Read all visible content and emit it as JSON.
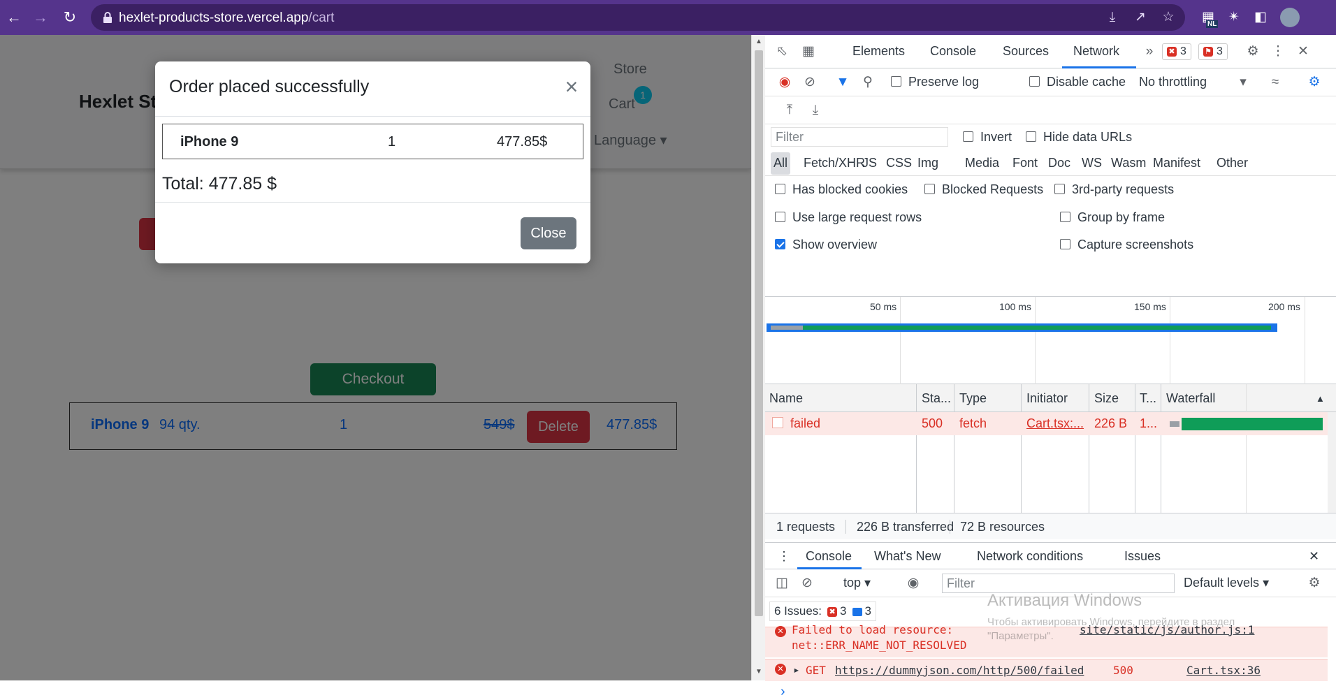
{
  "browser": {
    "url_host": "hexlet-products-store.vercel.app",
    "url_path": "/cart",
    "profile_badge": "NL"
  },
  "page": {
    "brand": "Hexlet Sto",
    "nav": {
      "store": "Store",
      "cart": "Cart",
      "cart_count": "1",
      "language": "Language ▾"
    },
    "total_partial": "$",
    "checkout_label": "Checkout",
    "cart_row": {
      "name": "iPhone 9",
      "stock": "94 qty.",
      "quantity": "1",
      "old_price": "549$",
      "delete_label": "Delete",
      "price": "477.85$"
    }
  },
  "modal": {
    "title": "Order placed successfully",
    "item": {
      "name": "iPhone 9",
      "quantity": "1",
      "price": "477.85$"
    },
    "total": "Total: 477.85 $",
    "close_label": "Close"
  },
  "devtools": {
    "tabs": [
      "Elements",
      "Console",
      "Sources",
      "Network"
    ],
    "active_tab": "Network",
    "errors_count": "3",
    "warnings_count": "3",
    "options": {
      "preserve_log": "Preserve log",
      "disable_cache": "Disable cache",
      "throttling": "No throttling",
      "filter_placeholder": "Filter",
      "invert": "Invert",
      "hide_data_urls": "Hide data URLs",
      "has_blocked_cookies": "Has blocked cookies",
      "blocked_requests": "Blocked Requests",
      "third_party": "3rd-party requests",
      "large_rows": "Use large request rows",
      "group_by_frame": "Group by frame",
      "show_overview": "Show overview",
      "capture_screenshots": "Capture screenshots"
    },
    "type_filters": [
      "All",
      "Fetch/XHR",
      "JS",
      "CSS",
      "Img",
      "Media",
      "Font",
      "Doc",
      "WS",
      "Wasm",
      "Manifest",
      "Other"
    ],
    "timeline_ticks": [
      "50 ms",
      "100 ms",
      "150 ms",
      "200 ms"
    ],
    "columns": [
      "Name",
      "Sta...",
      "Type",
      "Initiator",
      "Size",
      "T...",
      "Waterfall"
    ],
    "request": {
      "name": "failed",
      "status": "500",
      "type": "fetch",
      "initiator": "Cart.tsx:...",
      "size": "226 B",
      "time": "1..."
    },
    "summary": {
      "requests": "1 requests",
      "transferred": "226 B transferred",
      "resources": "72 B resources"
    },
    "drawer": {
      "tabs": [
        "Console",
        "What's New",
        "Network conditions",
        "Issues"
      ],
      "context": "top",
      "filter_placeholder": "Filter",
      "levels": "Default levels",
      "issues_label": "6 Issues:",
      "issues_errors": "3",
      "issues_info": "3",
      "messages": [
        {
          "text_1": "Failed to load resource:",
          "text_2": "net::ERR_NAME_NOT_RESOLVED",
          "source": "site/static/js/author.js:1"
        },
        {
          "method": "GET",
          "url": "https://dummyjson.com/http/500/failed",
          "status": "500",
          "source": "Cart.tsx:36"
        }
      ],
      "prompt": "›"
    },
    "watermark": {
      "line1": "Активация Windows",
      "line2": "Чтобы активировать Windows, перейдите в раздел",
      "line3": "\"Параметры\"."
    }
  }
}
